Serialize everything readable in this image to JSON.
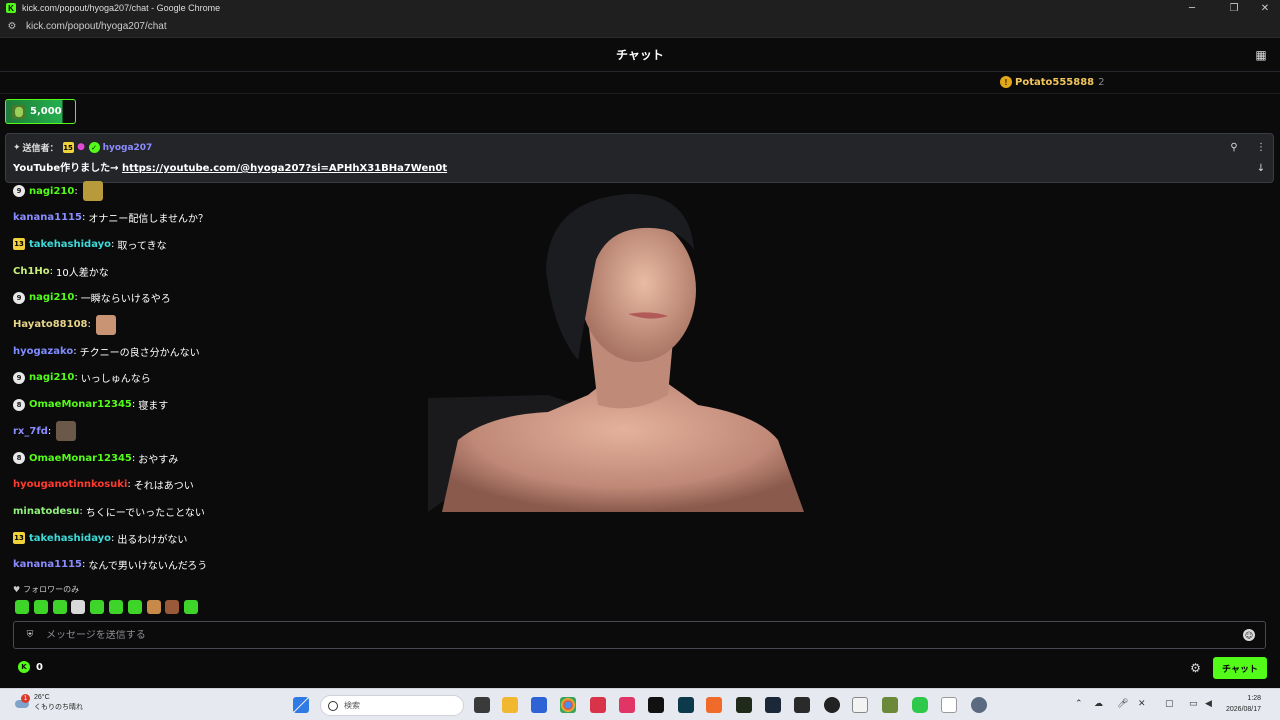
{
  "browser": {
    "window_title": "kick.com/popout/hyoga207/chat - Google Chrome",
    "url": "kick.com/popout/hyoga207/chat",
    "favicon_letter": "K"
  },
  "header": {
    "title": "チャット"
  },
  "top_gifter": {
    "name": "Potato555888",
    "count": "2",
    "coin_letter": "!"
  },
  "goal": {
    "value": "5,000"
  },
  "pinned": {
    "sender_label": "送信者：",
    "sub_badge": "15",
    "user": "hyoga207",
    "text": "YouTube作りました→ ",
    "link": "https://youtube.com/@hyoga207?si=APHhX31BHa7Wen0t"
  },
  "messages": [
    {
      "level": "9",
      "badge": "circle",
      "user": "nagi210",
      "color": "#53fc18",
      "text": "",
      "emote": "#b99a3a"
    },
    {
      "level": "",
      "badge": "",
      "user": "kanana1115",
      "color": "#8b8cff",
      "text": "オナニー配信しませんか？"
    },
    {
      "level": "13",
      "badge": "square",
      "user": "takehashidayo",
      "color": "#3ddad7",
      "text": "取ってきな"
    },
    {
      "level": "",
      "badge": "",
      "user": "Ch1Ho",
      "color": "#c8f07a",
      "text": "10人差かな"
    },
    {
      "level": "9",
      "badge": "circle",
      "user": "nagi210",
      "color": "#53fc18",
      "text": "一瞬ならいけるやろ"
    },
    {
      "level": "",
      "badge": "",
      "user": "Hayato88108",
      "color": "#e8d48a",
      "text": "",
      "emote": "#c89474"
    },
    {
      "level": "",
      "badge": "",
      "user": "hyogazako",
      "color": "#7f8cff",
      "text": "チクニーの良さ分かんない"
    },
    {
      "level": "9",
      "badge": "circle",
      "user": "nagi210",
      "color": "#53fc18",
      "text": "いっしゅんなら"
    },
    {
      "level": "8",
      "badge": "circle",
      "user": "OmaeMonar12345",
      "color": "#53fc18",
      "text": "寝ます"
    },
    {
      "level": "",
      "badge": "",
      "user": "rx_7fd",
      "color": "#8b8cff",
      "text": "",
      "emote": "#6a5848"
    },
    {
      "level": "8",
      "badge": "circle",
      "user": "OmaeMonar12345",
      "color": "#53fc18",
      "text": "おやすみ"
    },
    {
      "level": "",
      "badge": "",
      "user": "hyouganotinnkosuki",
      "color": "#ff3a2e",
      "text": "それはあつい"
    },
    {
      "level": "",
      "badge": "",
      "user": "minatodesu",
      "color": "#8ff07a",
      "text": "ちくにーでいったことない"
    },
    {
      "level": "13",
      "badge": "square",
      "user": "takehashidayo",
      "color": "#3ddad7",
      "text": "出るわけがない"
    },
    {
      "level": "",
      "badge": "",
      "user": "kanana1115",
      "color": "#8b8cff",
      "text": "なんで男いけないんだろう"
    }
  ],
  "follow_only": "フォロワーのみ",
  "emote_colors": [
    "#3fd42a",
    "#3fd42a",
    "#3fd42a",
    "#d9d9d9",
    "#3fd42a",
    "#3fd42a",
    "#3fd42a",
    "#c88a4a",
    "#9a5a3a",
    "#3fd42a"
  ],
  "input": {
    "placeholder": "メッセージを送信する"
  },
  "footer": {
    "points": "0",
    "send_label": "チャット"
  },
  "taskbar": {
    "temperature": "26°C",
    "weather": "くもりのち晴れ",
    "weather_badge": "1",
    "search_placeholder": "検索",
    "time": "1:28",
    "date": "2026/08/17"
  }
}
